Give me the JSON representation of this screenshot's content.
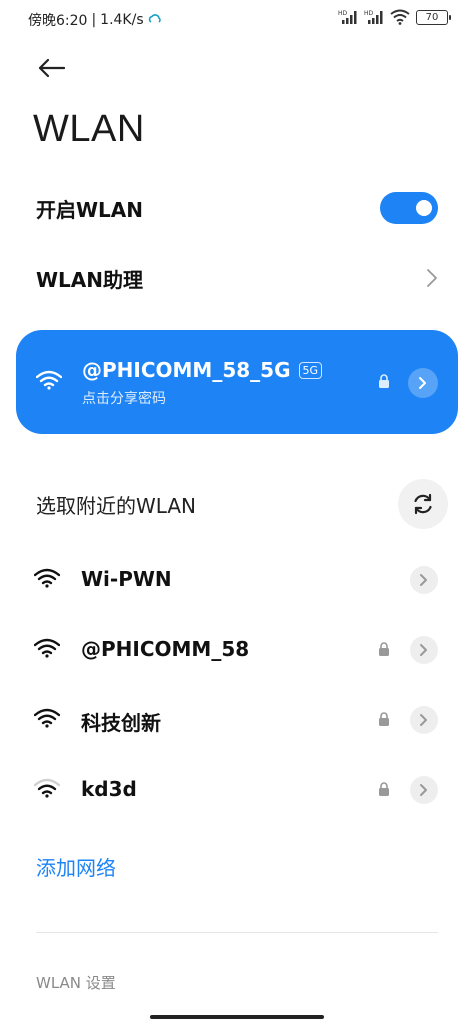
{
  "status_bar": {
    "time": "傍晚6:20",
    "speed": "1.4K/s",
    "signal_label": "HD",
    "battery": "70"
  },
  "header": {
    "title": "WLAN"
  },
  "settings": {
    "wlan_toggle_label": "开启WLAN",
    "wlan_enabled": true,
    "assistant_label": "WLAN助理"
  },
  "connected": {
    "ssid": "@PHICOMM_58_5G",
    "band": "5G",
    "subtitle": "点击分享密码",
    "locked": true
  },
  "nearby": {
    "header": "选取附近的WLAN",
    "networks": [
      {
        "ssid": "Wi-PWN",
        "locked": false,
        "signal": "strong"
      },
      {
        "ssid": "@PHICOMM_58",
        "locked": true,
        "signal": "strong"
      },
      {
        "ssid": "科技创新",
        "locked": true,
        "signal": "strong"
      },
      {
        "ssid": "kd3d",
        "locked": true,
        "signal": "weak"
      }
    ]
  },
  "actions": {
    "add_network": "添加网络"
  },
  "footer": {
    "settings_label": "WLAN 设置"
  },
  "colors": {
    "accent": "#1e84f5"
  }
}
